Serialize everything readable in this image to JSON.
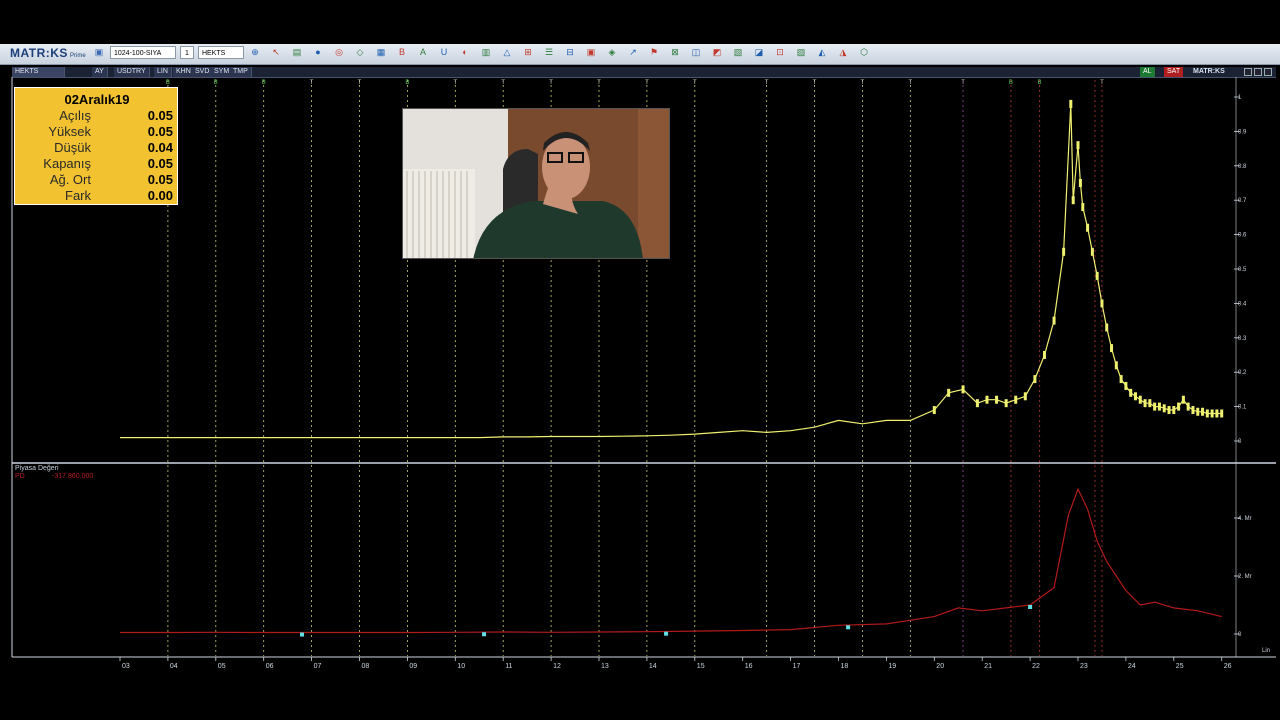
{
  "toolbar": {
    "logo": "MATR:KS",
    "logo_sub": "Prime",
    "layout_combo": "1024-100-SIYA",
    "symbol_combo": "HEKTS",
    "period_combo": "1"
  },
  "subbar": {
    "symbol": "HEKTS",
    "buttons": [
      "AY",
      "USDTRY",
      "LIN",
      "KHN",
      "SVD",
      "SYM",
      "TMP"
    ],
    "al_label": "AL",
    "sat_label": "SAT",
    "brand": "MATR:KS"
  },
  "info_box": {
    "date": "02Aralık19",
    "rows": [
      {
        "label": "Açılış",
        "value": "0.05"
      },
      {
        "label": "Yüksek",
        "value": "0.05"
      },
      {
        "label": "Düşük",
        "value": "0.04"
      },
      {
        "label": "Kapanış",
        "value": "0.05"
      },
      {
        "label": "Ağ. Ort",
        "value": "0.05"
      },
      {
        "label": "Fark",
        "value": "0.00"
      }
    ]
  },
  "lower_panel": {
    "title": "Piyasa Değeri",
    "indicator": "PD",
    "indicator_value": "-317.860.000",
    "scale_label": "Lin"
  },
  "chart_data": [
    {
      "type": "line",
      "name": "price",
      "color": "#f0f070",
      "x_labels": [
        "03",
        "04",
        "05",
        "06",
        "07",
        "08",
        "09",
        "10",
        "11",
        "12",
        "13",
        "14",
        "15",
        "16",
        "17",
        "18",
        "19",
        "20",
        "21",
        "22",
        "23",
        "24",
        "25",
        "26"
      ],
      "y_ticks": [
        "1",
        "0.9",
        "0.8",
        "0.7",
        "0.6",
        "0.5",
        "0.4",
        "0.3",
        "0.2",
        "0.1",
        "0"
      ],
      "ylim": [
        0,
        1
      ],
      "x": [
        0,
        0.5,
        1,
        1.5,
        2,
        2.5,
        3,
        3.5,
        4,
        4.5,
        5,
        5.5,
        6,
        6.5,
        7,
        7.5,
        8,
        8.5,
        9,
        9.5,
        10,
        10.5,
        11,
        11.5,
        12,
        12.5,
        13,
        13.5,
        14,
        14.5,
        15,
        15.5,
        16,
        16.5,
        17,
        17.3,
        17.6,
        17.9,
        18.1,
        18.3,
        18.5,
        18.7,
        18.9,
        19.1,
        19.3,
        19.5,
        19.7,
        19.85,
        19.9,
        20,
        20.05,
        20.1,
        20.2,
        20.3,
        20.4,
        20.5,
        20.6,
        20.7,
        20.8,
        20.9,
        21,
        21.1,
        21.2,
        21.3,
        21.4,
        21.5,
        21.6,
        21.7,
        21.8,
        21.9,
        22,
        22.1,
        22.2,
        22.3,
        22.4,
        22.5,
        22.6,
        22.7,
        22.8,
        22.9,
        23
      ],
      "y": [
        0.01,
        0.01,
        0.01,
        0.01,
        0.01,
        0.01,
        0.01,
        0.01,
        0.01,
        0.01,
        0.01,
        0.01,
        0.01,
        0.01,
        0.01,
        0.01,
        0.012,
        0.012,
        0.013,
        0.013,
        0.013,
        0.014,
        0.015,
        0.017,
        0.02,
        0.025,
        0.03,
        0.025,
        0.03,
        0.04,
        0.06,
        0.05,
        0.06,
        0.06,
        0.09,
        0.14,
        0.15,
        0.11,
        0.12,
        0.12,
        0.11,
        0.12,
        0.13,
        0.18,
        0.25,
        0.35,
        0.55,
        0.98,
        0.7,
        0.86,
        0.75,
        0.68,
        0.62,
        0.55,
        0.48,
        0.4,
        0.33,
        0.27,
        0.22,
        0.18,
        0.16,
        0.14,
        0.13,
        0.12,
        0.11,
        0.11,
        0.1,
        0.1,
        0.095,
        0.09,
        0.09,
        0.1,
        0.12,
        0.1,
        0.09,
        0.085,
        0.085,
        0.08,
        0.08,
        0.08,
        0.08
      ],
      "signal_labels": [
        "B",
        "B",
        "B",
        "T",
        "T",
        "B",
        "T",
        "T",
        "T",
        "T",
        "T",
        "T",
        "T",
        "T",
        "T",
        "T",
        "T",
        "B",
        "B",
        "T"
      ]
    },
    {
      "type": "line",
      "name": "Piyasa Değeri",
      "color": "#b21a1a",
      "y_ticks": [
        "4. Mr",
        "2. Mr",
        "0"
      ],
      "ylim": [
        0,
        5
      ],
      "x": [
        0,
        1,
        2,
        3,
        4,
        5,
        6,
        7,
        8,
        9,
        10,
        11,
        12,
        13,
        14,
        15,
        16,
        17,
        17.5,
        18,
        18.5,
        19,
        19.5,
        19.8,
        20,
        20.2,
        20.4,
        20.6,
        20.8,
        21,
        21.3,
        21.6,
        22,
        22.5,
        23
      ],
      "y": [
        0.05,
        0.05,
        0.06,
        0.05,
        0.05,
        0.05,
        0.05,
        0.06,
        0.07,
        0.06,
        0.07,
        0.08,
        0.1,
        0.12,
        0.15,
        0.3,
        0.35,
        0.6,
        0.9,
        0.8,
        0.9,
        1.0,
        1.6,
        4.1,
        5.0,
        4.3,
        3.2,
        2.5,
        2.0,
        1.5,
        1.0,
        1.1,
        0.9,
        0.8,
        0.6
      ],
      "markers_x": [
        3.8,
        7.6,
        11.4,
        15.2,
        19.0
      ]
    }
  ]
}
